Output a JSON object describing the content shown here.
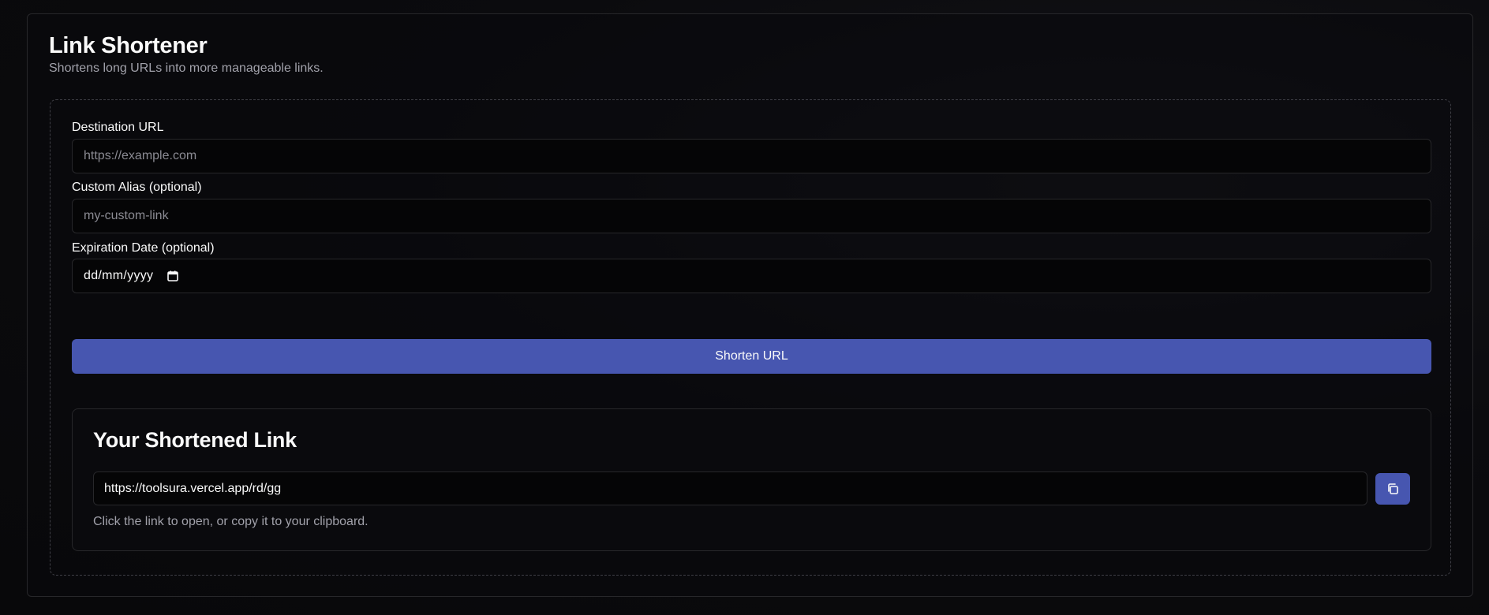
{
  "header": {
    "title": "Link Shortener",
    "description": "Shortens long URLs into more manageable links."
  },
  "form": {
    "destination": {
      "label": "Destination URL",
      "placeholder": "https://example.com",
      "value": ""
    },
    "alias": {
      "label": "Custom Alias (optional)",
      "placeholder": "my-custom-link",
      "value": ""
    },
    "expiration": {
      "label": "Expiration Date (optional)",
      "display": "dd/mm/yyyy",
      "icon": "calendar-icon"
    },
    "submit_label": "Shorten URL"
  },
  "result": {
    "title": "Your Shortened Link",
    "short_url": "https://toolsura.vercel.app/rd/gg",
    "copy_icon": "copy-icon",
    "hint": "Click the link to open, or copy it to your clipboard."
  },
  "colors": {
    "background": "#09090b",
    "accent": "#4756b0",
    "border": "#27272a",
    "muted_text": "#a1a1aa"
  }
}
